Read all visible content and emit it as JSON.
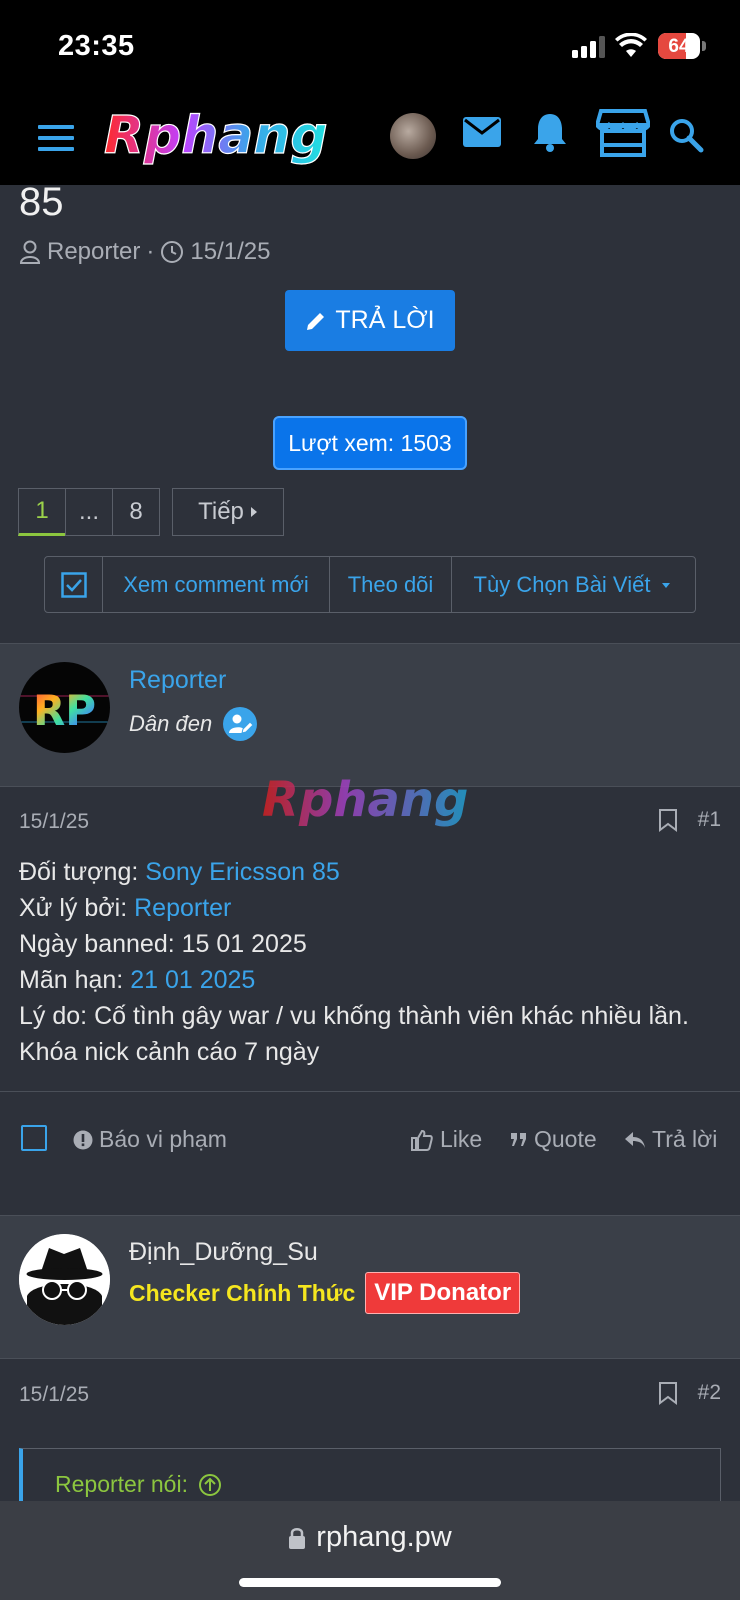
{
  "status_bar": {
    "time": "23:35",
    "battery": "64"
  },
  "header": {
    "logo_text": "Rphang",
    "icons": [
      "menu-icon",
      "avatar",
      "mail-icon",
      "bell-icon",
      "store-icon",
      "search-icon"
    ]
  },
  "thread": {
    "title_fragment": "85",
    "author": "Reporter",
    "separator": "·",
    "date": "15/1/25",
    "reply_label": "TRẢ LỜI",
    "views_label": "Lượt xem: 1503"
  },
  "pager": {
    "current": "1",
    "ellipsis": "...",
    "last": "8",
    "next_label": "Tiếp"
  },
  "actions": {
    "new_comments": "Xem comment mới",
    "follow": "Theo dõi",
    "options": "Tùy Chọn Bài Viết"
  },
  "posts": [
    {
      "username": "Reporter",
      "user_title": "Dân đen",
      "avatar_text": "RP",
      "date": "15/1/25",
      "number": "#1",
      "lines": [
        {
          "label": "Đối tượng: ",
          "value": "Sony Ericsson 85",
          "link": true
        },
        {
          "label": "Xử lý bởi: ",
          "value": "Reporter",
          "link": true
        },
        {
          "label": "Ngày banned: ",
          "value": "15 01 2025",
          "link": false
        },
        {
          "label": "Mãn hạn: ",
          "value": "21 01 2025",
          "link": true
        },
        {
          "label": "Lý do: ",
          "value": "Cố tình gây war / vu khống thành viên khác nhiều lần.",
          "link": false
        },
        {
          "label": "",
          "value": "Khóa nick cảnh cáo 7 ngày",
          "link": false
        }
      ],
      "footer": {
        "report": "Báo vi phạm",
        "like": "Like",
        "quote": "Quote",
        "reply": "Trả lời"
      }
    },
    {
      "username": "Định_Dưỡng_Su",
      "badge_checker": "Checker Chính Thức",
      "badge_vip": "VIP Donator",
      "date": "15/1/25",
      "number": "#2",
      "quote_label": "Reporter nói:"
    }
  ],
  "browser": {
    "url": "rphang.pw"
  },
  "colors": {
    "accent": "#3aa4ea",
    "button": "#1a7de3",
    "green": "#8cc63f",
    "vip": "#ef3a3a",
    "checker": "#f5e61f"
  }
}
